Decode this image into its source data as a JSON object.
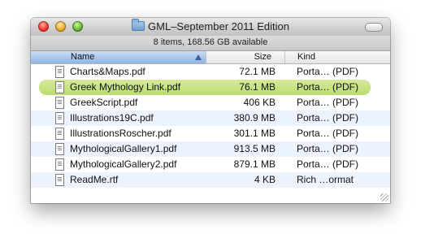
{
  "window": {
    "title": "GML–September 2011 Edition",
    "folder_icon": "folder-icon"
  },
  "status": {
    "text": "8 items, 168.56 GB available"
  },
  "columns": {
    "name": "Name",
    "size": "Size",
    "kind": "Kind"
  },
  "files": [
    {
      "name": "Charts&Maps.pdf",
      "size": "72.1 MB",
      "kind": "Porta… (PDF)"
    },
    {
      "name": "Greek Mythology Link.pdf",
      "size": "76.1 MB",
      "kind": "Porta… (PDF)",
      "label_color": "#c7e383"
    },
    {
      "name": "GreekScript.pdf",
      "size": "406 KB",
      "kind": "Porta… (PDF)"
    },
    {
      "name": "Illustrations19C.pdf",
      "size": "380.9 MB",
      "kind": "Porta… (PDF)"
    },
    {
      "name": "IllustrationsRoscher.pdf",
      "size": "301.1 MB",
      "kind": "Porta… (PDF)"
    },
    {
      "name": "MythologicalGallery1.pdf",
      "size": "913.5 MB",
      "kind": "Porta… (PDF)"
    },
    {
      "name": "MythologicalGallery2.pdf",
      "size": "879.1 MB",
      "kind": "Porta… (PDF)"
    },
    {
      "name": "ReadMe.rtf",
      "size": "4 KB",
      "kind": "Rich …ormat"
    }
  ],
  "colors": {
    "header_selected": "#8fb4e6",
    "row_alternate": "#edf3fe",
    "green_label": "#c7e383"
  }
}
